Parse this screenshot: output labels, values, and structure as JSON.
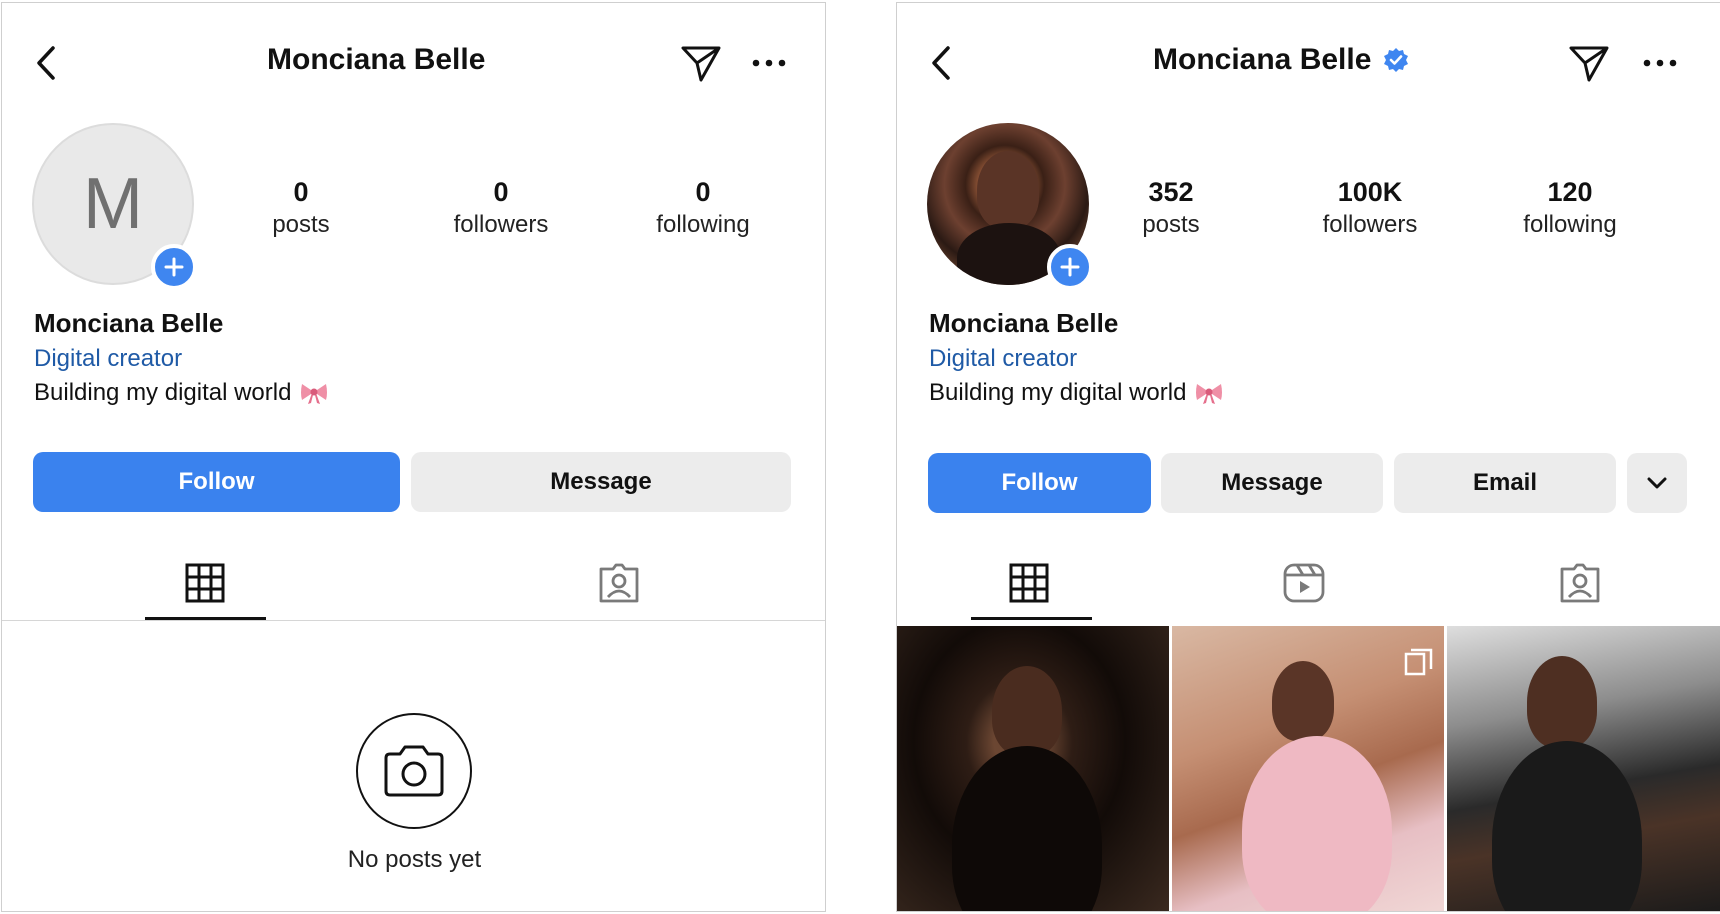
{
  "left": {
    "title": "Monciana Belle",
    "avatar_letter": "M",
    "stats": [
      {
        "value": "0",
        "label": "posts"
      },
      {
        "value": "0",
        "label": "followers"
      },
      {
        "value": "0",
        "label": "following"
      }
    ],
    "name": "Monciana Belle",
    "category": "Digital creator",
    "bio": "Building my digital world",
    "buttons": {
      "follow": "Follow",
      "message": "Message"
    },
    "tabs": [
      "grid-icon",
      "tagged-icon"
    ],
    "empty_text": "No posts yet"
  },
  "right": {
    "title": "Monciana Belle",
    "verified": true,
    "stats": [
      {
        "value": "352",
        "label": "posts"
      },
      {
        "value": "100K",
        "label": "followers"
      },
      {
        "value": "120",
        "label": "following"
      }
    ],
    "name": "Monciana Belle",
    "category": "Digital creator",
    "bio": "Building my digital world",
    "buttons": {
      "follow": "Follow",
      "message": "Message",
      "email": "Email"
    },
    "tabs": [
      "grid-icon",
      "reels-icon",
      "tagged-icon"
    ]
  },
  "colors": {
    "accent": "#3a82ee",
    "link": "#1f5aa6",
    "button_gray": "#ececec",
    "verified": "#3f86f0"
  }
}
